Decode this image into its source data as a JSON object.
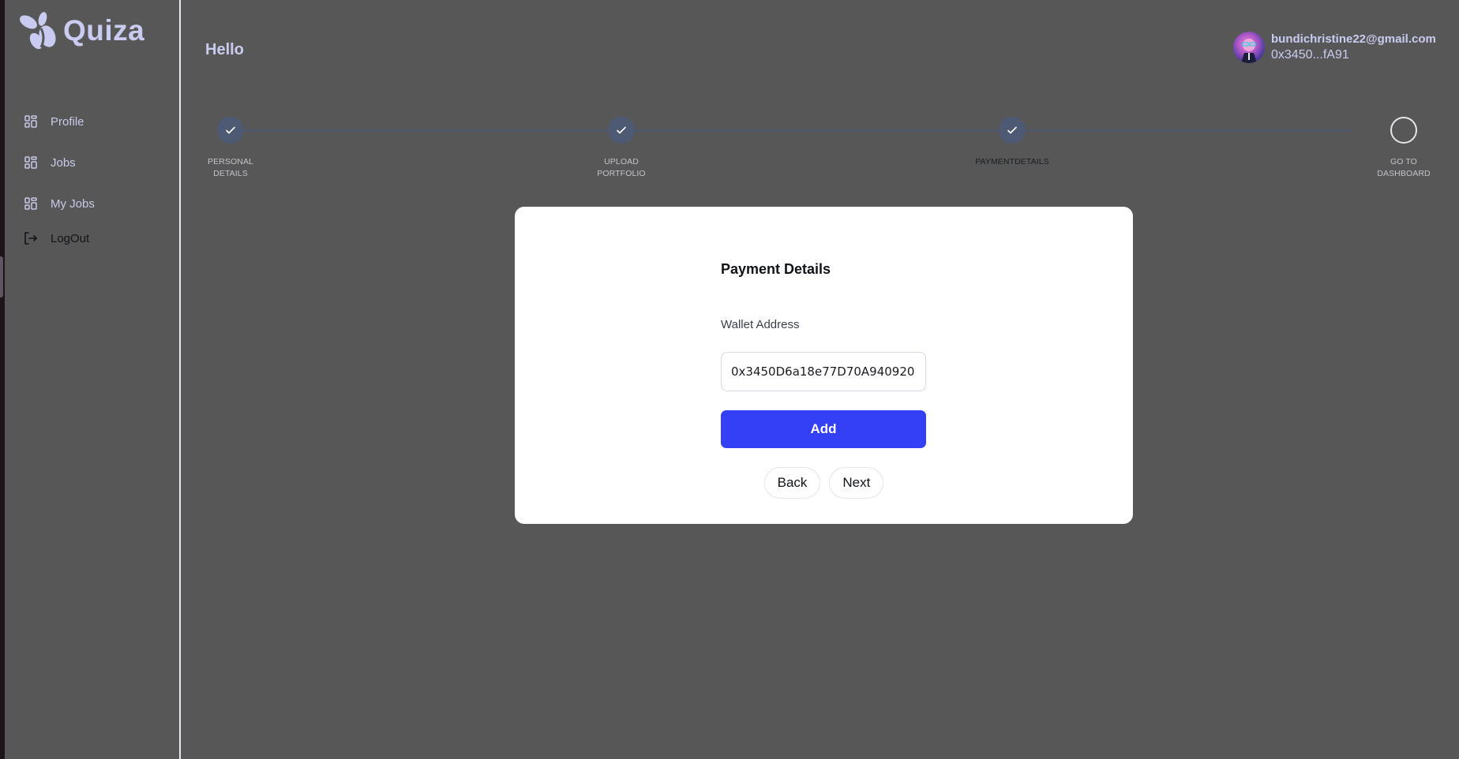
{
  "app": {
    "name": "Quiza",
    "brand_color": "#c9cbf0",
    "accent_color": "#3340f5"
  },
  "sidebar": {
    "items": [
      {
        "label": "Profile",
        "icon": "dashboard-grid-icon"
      },
      {
        "label": "Jobs",
        "icon": "dashboard-grid-icon"
      },
      {
        "label": "My Jobs",
        "icon": "dashboard-grid-icon"
      },
      {
        "label": "LogOut",
        "icon": "logout-icon"
      }
    ]
  },
  "header": {
    "greeting": "Hello",
    "user": {
      "email": "bundichristine22@gmail.com",
      "wallet_short": "0x3450...fA91"
    }
  },
  "stepper": {
    "steps": [
      {
        "label_line1": "PERSONAL",
        "label_line2": "DETAILS",
        "status": "completed"
      },
      {
        "label_line1": "UPLOAD",
        "label_line2": "PORTFOLIO",
        "status": "completed"
      },
      {
        "label_line1": "PAYMENTDETAILS",
        "label_line2": "",
        "status": "active"
      },
      {
        "label_line1": "GO TO",
        "label_line2": "DASHBOARD",
        "status": "pending"
      }
    ]
  },
  "form": {
    "title": "Payment Details",
    "wallet_label": "Wallet Address",
    "wallet_value": "0x3450D6a18e77D70A940920",
    "add_label": "Add",
    "back_label": "Back",
    "next_label": "Next"
  }
}
